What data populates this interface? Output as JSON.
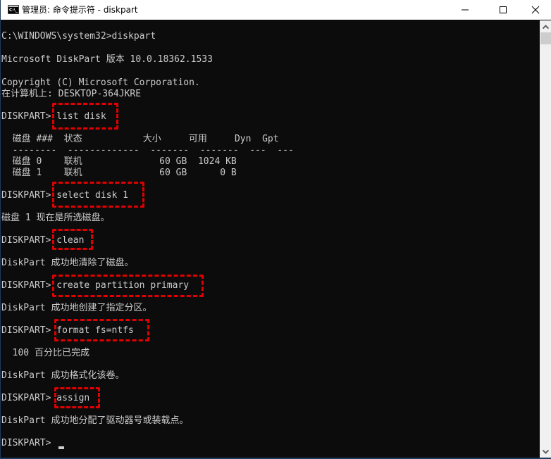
{
  "window": {
    "title": "管理员: 命令提示符 - diskpart",
    "app_icon_text": "C:\\_",
    "controls": {
      "minimize": "—",
      "maximize": "☐",
      "close": "✕"
    }
  },
  "console": {
    "lines": [
      "C:\\WINDOWS\\system32>diskpart",
      "Microsoft DiskPart 版本 10.0.18362.1533",
      "Copyright (C) Microsoft Corporation.",
      "在计算机上: DESKTOP-364JKRE",
      "DISKPART> list disk",
      "  磁盘 ###  状态           大小     可用     Dyn  Gpt",
      "  --------  -------------  -------  -------  ---  ---",
      "  磁盘 0    联机              60 GB  1024 KB",
      "  磁盘 1    联机              60 GB      0 B",
      "DISKPART> select disk 1",
      "磁盘 1 现在是所选磁盘。",
      "DISKPART> clean",
      "DiskPart 成功地清除了磁盘。",
      "DISKPART> create partition primary",
      "DiskPart 成功地创建了指定分区。",
      "DISKPART> format fs=ntfs",
      "  100 百分比已完成",
      "DiskPart 成功格式化该卷。",
      "DISKPART> assign",
      "DiskPart 成功地分配了驱动器号或装载点。",
      "DISKPART> "
    ],
    "highlighted_commands": [
      "list disk",
      "select disk 1",
      "clean",
      "create partition primary",
      "format fs=ntfs",
      "assign"
    ],
    "highlight_color": "#e00000",
    "text_color": "#cccccc",
    "background_color": "#0c0c0c"
  }
}
